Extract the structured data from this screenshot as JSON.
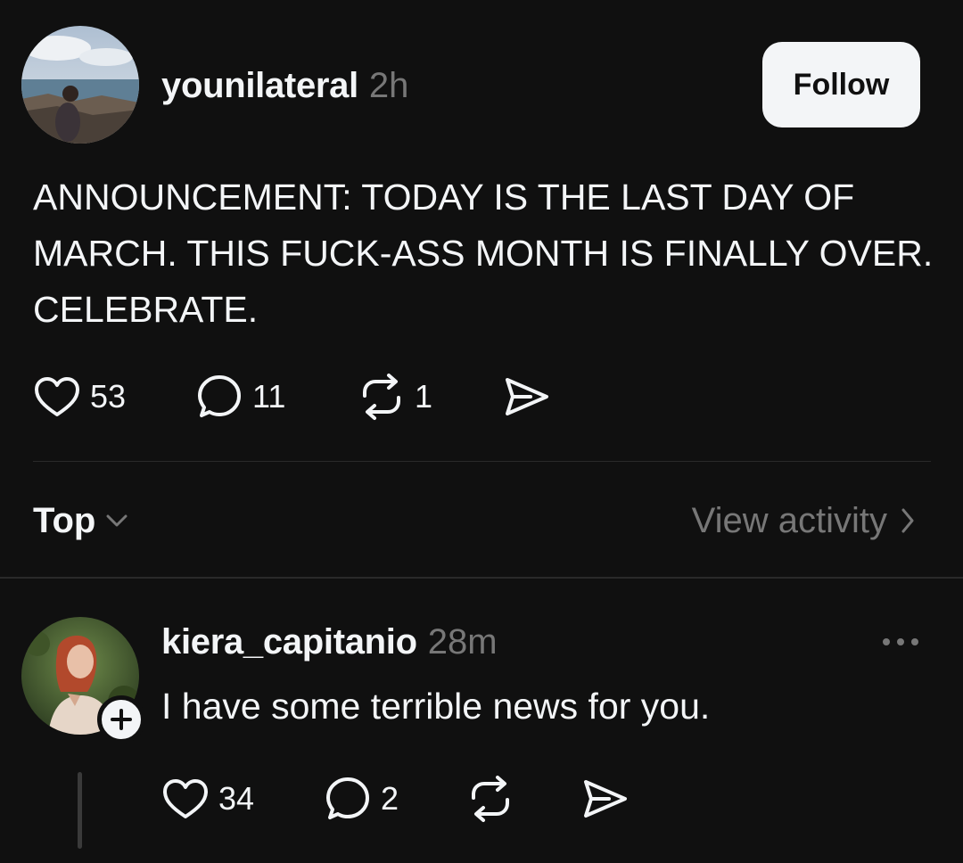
{
  "post": {
    "username": "younilateral",
    "timestamp": "2h",
    "follow_label": "Follow",
    "text": "ANNOUNCEMENT: TODAY IS THE LAST DAY OF MARCH. THIS FUCK-ASS MONTH IS FINALLY OVER. CELEBRATE.",
    "likes": "53",
    "comments": "11",
    "reposts": "1"
  },
  "sort": {
    "label": "Top",
    "view_activity": "View activity"
  },
  "reply": {
    "username": "kiera_capitanio",
    "timestamp": "28m",
    "text": "I have some terrible news for you.",
    "likes": "34",
    "comments": "2"
  },
  "icons": {
    "like": "heart-icon",
    "comment": "comment-bubble-icon",
    "repost": "repost-icon",
    "share": "send-icon",
    "sort": "chevron-down-icon",
    "activity": "chevron-right-icon",
    "more": "more-dots-icon",
    "follow_badge": "plus-icon"
  },
  "colors": {
    "background": "#101010",
    "text": "#f3f5f7",
    "secondary_text": "#777777",
    "divider": "#2a2a2a",
    "follow_button_bg": "#f3f5f7"
  }
}
